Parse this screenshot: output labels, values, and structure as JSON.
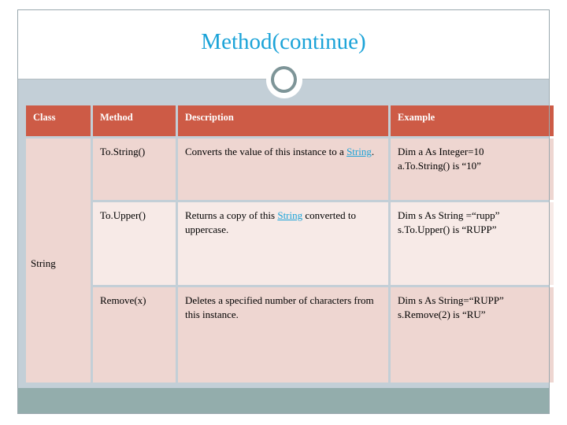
{
  "slide": {
    "title": "Method(continue)",
    "title_color": "#1ba3d8",
    "header_color": "#cd5b46",
    "body_color": "#c3cfd7",
    "footer_color": "#93adac",
    "row_tint_a": "#eed6d1",
    "row_tint_b": "#f7eae7",
    "link_color": "#1ba3d8"
  },
  "table": {
    "headers": {
      "class": "Class",
      "method": "Method",
      "description": "Description",
      "example": "Example"
    },
    "class_label": "String",
    "rows": [
      {
        "method": "To.String()",
        "description_before": "Converts the value of this instance to a ",
        "description_link": "String",
        "description_after": ".",
        "example_line1": "Dim a As Integer=10",
        "example_line2": "a.To.String() is “10”"
      },
      {
        "method": "To.Upper()",
        "description_before": "Returns a copy of this ",
        "description_link": "String",
        "description_after": " converted to uppercase.",
        "example_line1": "Dim s As String =“rupp”",
        "example_line2": "s.To.Upper() is “RUPP”"
      },
      {
        "method": "Remove(x)",
        "description_before": "Deletes a specified number of characters from this instance.",
        "description_link": "",
        "description_after": "",
        "example_line1": "Dim s As String=“RUPP”",
        "example_line2": "s.Remove(2) is “RU”"
      }
    ]
  }
}
